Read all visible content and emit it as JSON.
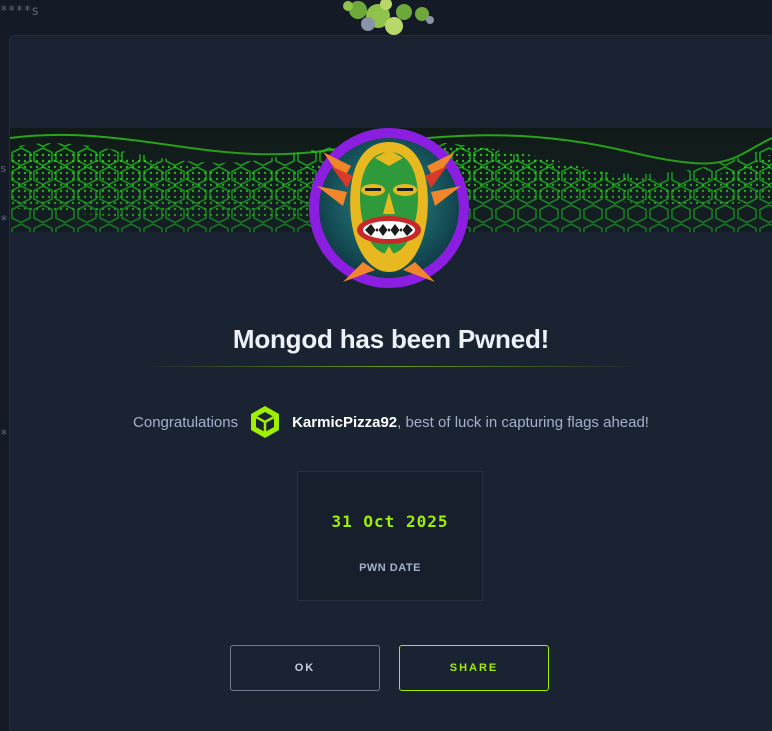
{
  "background": {
    "masked_text": "****s",
    "fragments": [
      "s",
      "*",
      "*"
    ]
  },
  "modal": {
    "title": "Mongod has been Pwned!",
    "congrats_prefix": "Congratulations",
    "username": "KarmicPizza92",
    "congrats_suffix": ", best of luck in capturing flags ahead!",
    "user_icon": "cube-icon",
    "avatar_icon": "tiki-mask-icon",
    "pwn_date": "31 Oct 2025",
    "pwn_date_label": "PWN DATE",
    "buttons": {
      "ok": "OK",
      "share": "SHARE"
    }
  },
  "colors": {
    "accent": "#9fef00",
    "avatar_ring": "#8b1ee0",
    "modal_bg": "#1a2332",
    "page_bg": "#141b26"
  }
}
